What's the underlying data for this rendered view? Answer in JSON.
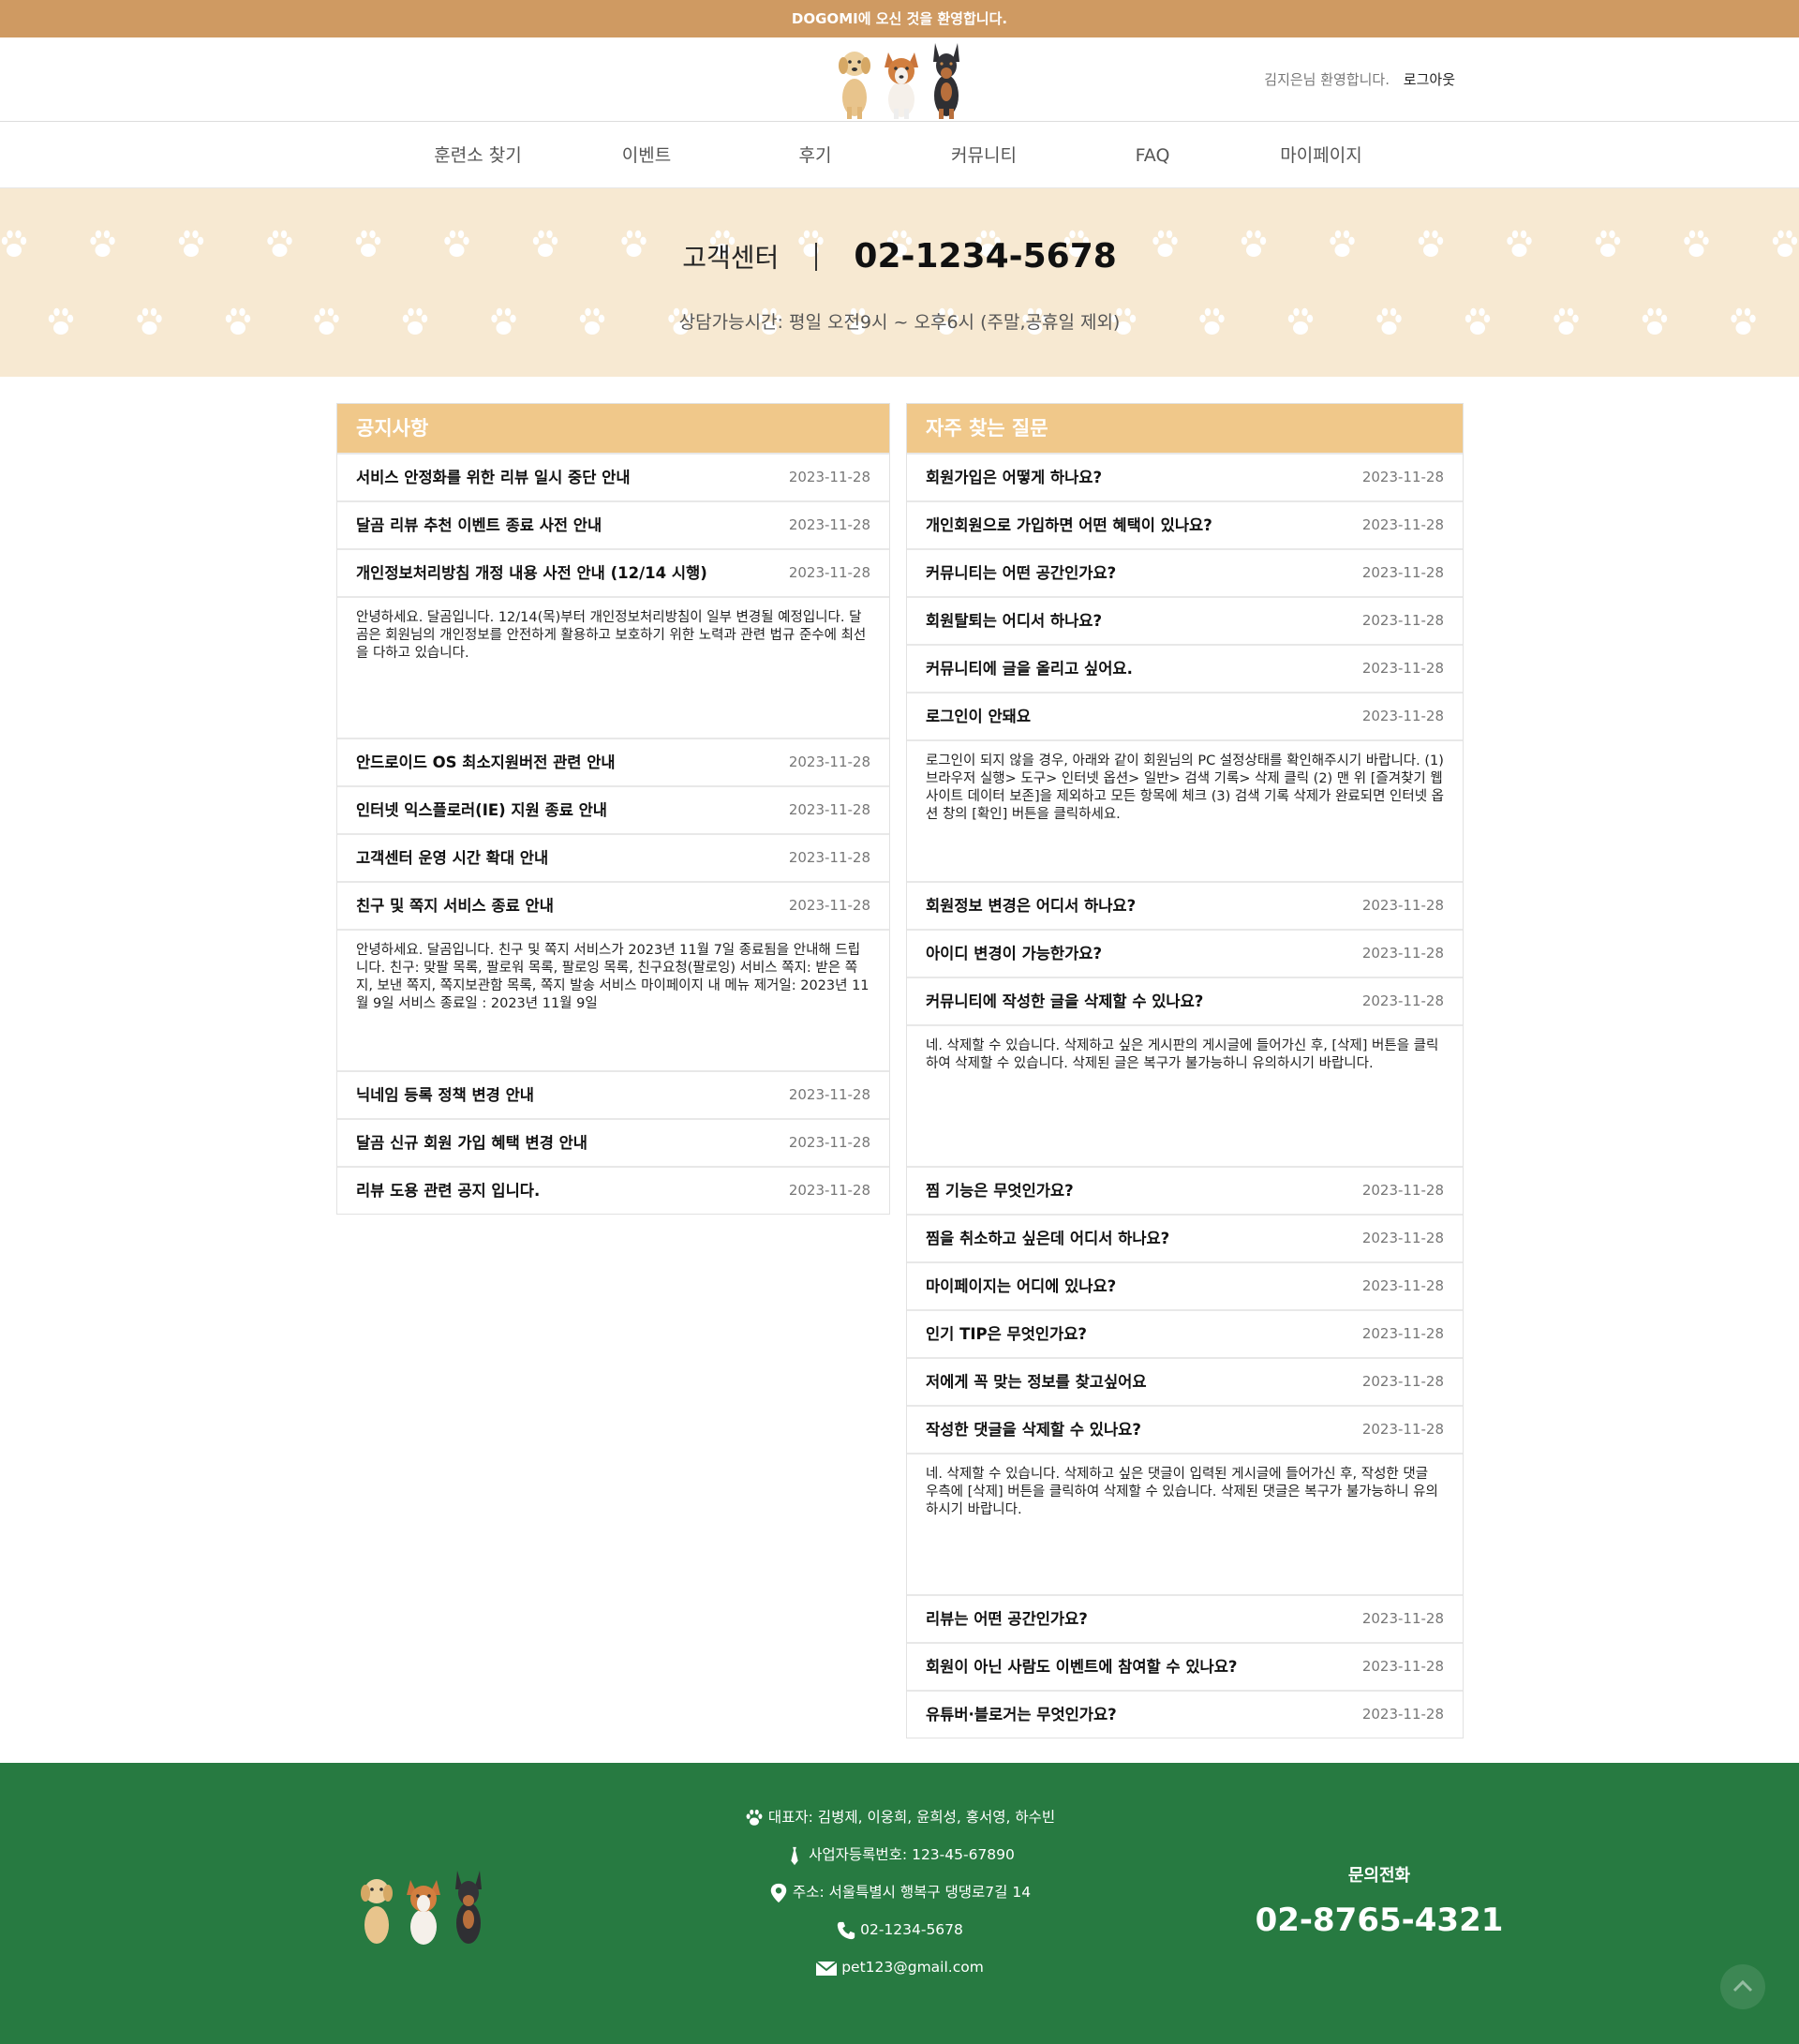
{
  "topbar": {
    "text": "DOGOMI에 오신 것을 환영합니다."
  },
  "header": {
    "welcome": "김지은님 환영합니다.",
    "logout": "로그아웃"
  },
  "nav": [
    {
      "label": "훈련소 찾기"
    },
    {
      "label": "이벤트"
    },
    {
      "label": "후기"
    },
    {
      "label": "커뮤니티"
    },
    {
      "label": "FAQ"
    },
    {
      "label": "마이페이지"
    }
  ],
  "hero": {
    "label": "고객센터",
    "phone": "02-1234-5678",
    "hours": "상담가능시간: 평일 오전9시 ~ 오후6시 (주말,공휴일 제외)"
  },
  "notice": {
    "title": "공지사항",
    "items": [
      {
        "title": "서비스 안정화를 위한 리뷰 일시 중단 안내",
        "date": "2023-11-28"
      },
      {
        "title": "달곰 리뷰 추천 이벤트 종료 사전 안내",
        "date": "2023-11-28"
      },
      {
        "title": "개인정보처리방침 개정 내용 사전 안내 (12/14 시행)",
        "date": "2023-11-28"
      },
      {
        "body": "안녕하세요. 달곰입니다. 12/14(목)부터 개인정보처리방침이 일부 변경될 예정입니다. 달곰은 회원님의 개인정보를 안전하게 활용하고 보호하기 위한 노력과 관련 법규 준수에 최선을 다하고 있습니다."
      },
      {
        "title": "안드로이드 OS 최소지원버전 관련 안내",
        "date": "2023-11-28"
      },
      {
        "title": "인터넷 익스플로러(IE) 지원 종료 안내",
        "date": "2023-11-28"
      },
      {
        "title": "고객센터 운영 시간 확대 안내",
        "date": "2023-11-28"
      },
      {
        "title": "친구 및 쪽지 서비스 종료 안내",
        "date": "2023-11-28"
      },
      {
        "body": "안녕하세요. 달곰입니다. 친구 및 쪽지 서비스가 2023년 11월 7일 종료됨을 안내해 드립니다. 친구: 맞팔 목록, 팔로워 목록, 팔로잉 목록, 친구요청(팔로잉) 서비스 쪽지: 받은 쪽지, 보낸 쪽지, 쪽지보관함 목록, 쪽지 발송 서비스 마이페이지 내 메뉴 제거일: 2023년 11월 9일 서비스 종료일 : 2023년 11월 9일"
      },
      {
        "title": "닉네임 등록 정책 변경 안내",
        "date": "2023-11-28"
      },
      {
        "title": "달곰 신규 회원 가입 혜택 변경 안내",
        "date": "2023-11-28"
      },
      {
        "title": "리뷰 도용 관련 공지 입니다.",
        "date": "2023-11-28"
      }
    ]
  },
  "faq": {
    "title": "자주 찾는 질문",
    "items": [
      {
        "title": "회원가입은 어떻게 하나요?",
        "date": "2023-11-28"
      },
      {
        "title": "개인회원으로 가입하면 어떤 혜택이 있나요?",
        "date": "2023-11-28"
      },
      {
        "title": "커뮤니티는 어떤 공간인가요?",
        "date": "2023-11-28"
      },
      {
        "title": "회원탈퇴는 어디서 하나요?",
        "date": "2023-11-28"
      },
      {
        "title": "커뮤니티에 글을 올리고 싶어요.",
        "date": "2023-11-28"
      },
      {
        "title": "로그인이 안돼요",
        "date": "2023-11-28"
      },
      {
        "body": "로그인이 되지 않을 경우, 아래와 같이 회원님의 PC 설정상태를 확인해주시기 바랍니다. (1) 브라우저 실행> 도구> 인터넷 옵션> 일반> 검색 기록> 삭제 클릭 (2) 맨 위 [즐겨찾기 웹 사이트 데이터 보존]을 제외하고 모든 항목에 체크 (3) 검색 기록 삭제가 완료되면 인터넷 옵션 창의 [확인] 버튼을 클릭하세요."
      },
      {
        "title": "회원정보 변경은 어디서 하나요?",
        "date": "2023-11-28"
      },
      {
        "title": "아이디 변경이 가능한가요?",
        "date": "2023-11-28"
      },
      {
        "title": "커뮤니티에 작성한 글을 삭제할 수 있나요?",
        "date": "2023-11-28"
      },
      {
        "body": "네. 삭제할 수 있습니다. 삭제하고 싶은 게시판의 게시글에 들어가신 후, [삭제] 버튼을 클릭하여 삭제할 수 있습니다. 삭제된 글은 복구가 불가능하니 유의하시기 바랍니다."
      },
      {
        "title": "찜 기능은 무엇인가요?",
        "date": "2023-11-28"
      },
      {
        "title": "찜을 취소하고 싶은데 어디서 하나요?",
        "date": "2023-11-28"
      },
      {
        "title": "마이페이지는 어디에 있나요?",
        "date": "2023-11-28"
      },
      {
        "title": "인기 TIP은 무엇인가요?",
        "date": "2023-11-28"
      },
      {
        "title": "저에게 꼭 맞는 정보를 찾고싶어요",
        "date": "2023-11-28"
      },
      {
        "title": "작성한 댓글을 삭제할 수 있나요?",
        "date": "2023-11-28"
      },
      {
        "body": "네. 삭제할 수 있습니다. 삭제하고 싶은 댓글이 입력된 게시글에 들어가신 후, 작성한 댓글 우측에 [삭제] 버튼을 클릭하여 삭제할 수 있습니다. 삭제된 댓글은 복구가 불가능하니 유의하시기 바랍니다."
      },
      {
        "title": "리뷰는 어떤 공간인가요?",
        "date": "2023-11-28"
      },
      {
        "title": "회원이 아닌 사람도 이벤트에 참여할 수 있나요?",
        "date": "2023-11-28"
      },
      {
        "title": "유튜버·블로거는 무엇인가요?",
        "date": "2023-11-28"
      }
    ]
  },
  "footer": {
    "lines": [
      {
        "icon": "paw-icon",
        "text": "대표자: 김병제, 이웅희, 윤희성, 홍서영, 하수빈"
      },
      {
        "icon": "tie-icon",
        "text": "사업자등록번호: 123-45-67890"
      },
      {
        "icon": "location-pin-icon",
        "text": "주소: 서울특별시 행복구 댕댕로7길 14"
      },
      {
        "icon": "phone-icon",
        "text": "02-1234-5678"
      },
      {
        "icon": "mail-icon",
        "text": "pet123@gmail.com"
      }
    ],
    "contact_label": "문의전화",
    "contact_phone": "02-8765-4321"
  },
  "colors": {
    "topbar": "#cf9a62",
    "hero_bg": "#f7e9d2",
    "panel_header": "#f0c88a",
    "footer_bg": "#277a41"
  }
}
